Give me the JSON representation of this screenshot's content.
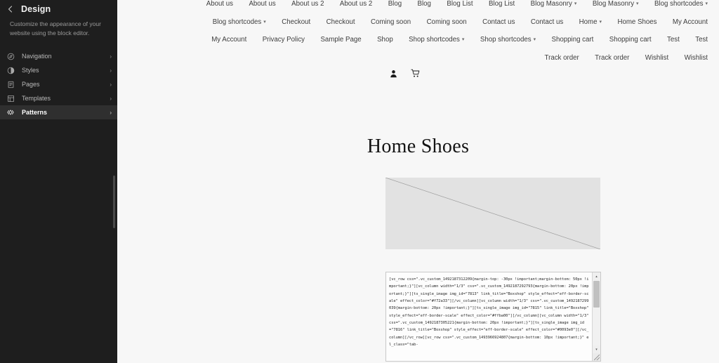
{
  "sidebar": {
    "back_icon": "chevron-left-icon",
    "title": "Design",
    "description": "Customize the appearance of your website using the block editor.",
    "items": [
      {
        "label": "Navigation",
        "icon": "compass-icon",
        "chevron": "›",
        "active": false
      },
      {
        "label": "Styles",
        "icon": "contrast-icon",
        "chevron": "›",
        "active": false
      },
      {
        "label": "Pages",
        "icon": "page-icon",
        "chevron": "›",
        "active": false
      },
      {
        "label": "Templates",
        "icon": "layout-icon",
        "chevron": "›",
        "active": false
      },
      {
        "label": "Patterns",
        "icon": "patterns-icon",
        "chevron": "›",
        "active": true
      }
    ]
  },
  "site": {
    "nav_rows": [
      [
        {
          "label": "About us",
          "caret": false
        },
        {
          "label": "About us",
          "caret": false
        },
        {
          "label": "About us 2",
          "caret": false
        },
        {
          "label": "About us 2",
          "caret": false
        },
        {
          "label": "Blog",
          "caret": false
        },
        {
          "label": "Blog",
          "caret": false
        },
        {
          "label": "Blog List",
          "caret": false
        },
        {
          "label": "Blog List",
          "caret": false
        },
        {
          "label": "Blog Masonry",
          "caret": true
        },
        {
          "label": "Blog Masonry",
          "caret": true
        },
        {
          "label": "Blog shortcodes",
          "caret": true
        }
      ],
      [
        {
          "label": "Blog shortcodes",
          "caret": true
        },
        {
          "label": "Checkout",
          "caret": false
        },
        {
          "label": "Checkout",
          "caret": false
        },
        {
          "label": "Coming soon",
          "caret": false
        },
        {
          "label": "Coming soon",
          "caret": false
        },
        {
          "label": "Contact us",
          "caret": false
        },
        {
          "label": "Contact us",
          "caret": false
        },
        {
          "label": "Home",
          "caret": true
        },
        {
          "label": "Home Shoes",
          "caret": false
        },
        {
          "label": "My Account",
          "caret": false
        }
      ],
      [
        {
          "label": "My Account",
          "caret": false
        },
        {
          "label": "Privacy Policy",
          "caret": false
        },
        {
          "label": "Sample Page",
          "caret": false
        },
        {
          "label": "Shop",
          "caret": false
        },
        {
          "label": "Shop shortcodes",
          "caret": true
        },
        {
          "label": "Shop shortcodes",
          "caret": true
        },
        {
          "label": "Shopping cart",
          "caret": false
        },
        {
          "label": "Shopping cart",
          "caret": false
        },
        {
          "label": "Test",
          "caret": false
        },
        {
          "label": "Test",
          "caret": false
        }
      ],
      [
        {
          "label": "Track order",
          "caret": false
        },
        {
          "label": "Track order",
          "caret": false
        },
        {
          "label": "Wishlist",
          "caret": false
        },
        {
          "label": "Wishlist",
          "caret": false
        }
      ]
    ],
    "toolbar_icons": [
      {
        "name": "account-icon"
      },
      {
        "name": "shopping-cart-icon"
      }
    ],
    "page_title": "Home Shoes",
    "image_placeholder": {
      "alt": "broken-image-placeholder"
    },
    "code_block": {
      "value": "[vc_row css=\".vc_custom_1492187312209{margin-top: -30px !important;margin-bottom: 50px !important;}\"][vc_column width=\"1/3\" css=\".vc_custom_1492187292793{margin-bottom: 20px !important;}\"][ts_single_image img_id=\"7813\" link_title=\"Boxshop\" style_effect=\"eff-border-scale\" effect_color=\"#f72a33\"][/vc_column][vc_column width=\"1/3\" css=\".vc_custom_1492187299039{margin-bottom: 20px !important;}\"][ts_single_image img_id=\"7815\" link_title=\"Boxshop\" style_effect=\"eff-border-scale\" effect_color=\"#ffba00\"][/vc_column][vc_column width=\"1/3\" css=\".vc_custom_1492187305221{margin-bottom: 20px !important;}\"][ts_single_image img_id=\"7816\" link_title=\"Boxshop\" style_effect=\"eff-border-scale\" effect_color=\"#0093e0\"][/vc_column][/vc_row][vc_row css=\".vc_custom_1493966924807{margin-bottom: 10px !important;}\" el_class=\"tab-",
      "scroll_up_icon": "▴",
      "scroll_down_icon": "▾"
    }
  },
  "colors": {
    "sidebar_bg": "#1e1e1e",
    "sidebar_active_bg": "#2f2f2f",
    "content_bg": "#f7f7f7",
    "placeholder_bg": "#e2e2e2"
  }
}
